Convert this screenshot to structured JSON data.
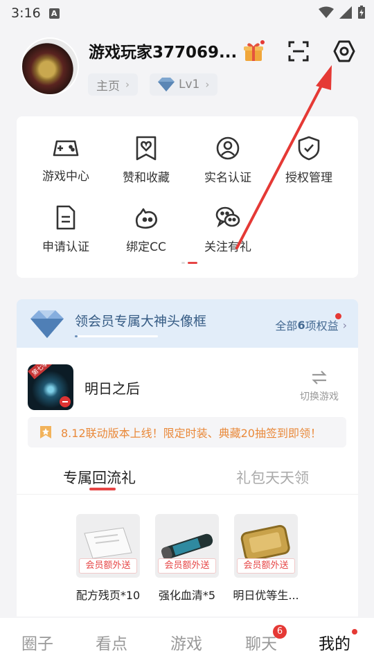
{
  "status_bar": {
    "time": "3:16",
    "indicator": "A"
  },
  "profile": {
    "username": "游戏玩家377069...",
    "home_label": "主页",
    "level_label": "Lv1"
  },
  "header_icons": {
    "gift": "gift-icon",
    "scan": "scan-icon",
    "settings": "settings-icon"
  },
  "services": [
    {
      "label": "游戏中心",
      "icon": "gamepad-icon"
    },
    {
      "label": "赞和收藏",
      "icon": "bookmark-heart-icon"
    },
    {
      "label": "实名认证",
      "icon": "user-circle-icon"
    },
    {
      "label": "授权管理",
      "icon": "shield-check-icon"
    },
    {
      "label": "申请认证",
      "icon": "document-icon"
    },
    {
      "label": "绑定CC",
      "icon": "cc-icon"
    },
    {
      "label": "关注有礼",
      "icon": "wechat-icon"
    }
  ],
  "vip": {
    "title": "领会员专属大神头像框",
    "link_prefix": "全部",
    "link_count": "6",
    "link_suffix": "项权益"
  },
  "game": {
    "badge": "第七季",
    "name": "明日之后",
    "switch_label": "切换游戏",
    "notice": "8.12联动版本上线！限定时装、典藏20抽签到即领！"
  },
  "tabs": {
    "active": "专属回流礼",
    "inactive": "礼包天天领"
  },
  "gifts": [
    {
      "tag": "会员额外送",
      "name": "配方残页*10"
    },
    {
      "tag": "会员额外送",
      "name": "强化血清*5"
    },
    {
      "tag": "会员额外送",
      "name": "明日优等生..."
    }
  ],
  "nav": [
    {
      "label": "圈子"
    },
    {
      "label": "看点"
    },
    {
      "label": "游戏"
    },
    {
      "label": "聊天",
      "badge": "6"
    },
    {
      "label": "我的"
    }
  ],
  "colors": {
    "accent": "#e64545",
    "vip_bg": "#e2edf9",
    "annotation_arrow": "#e53935"
  }
}
